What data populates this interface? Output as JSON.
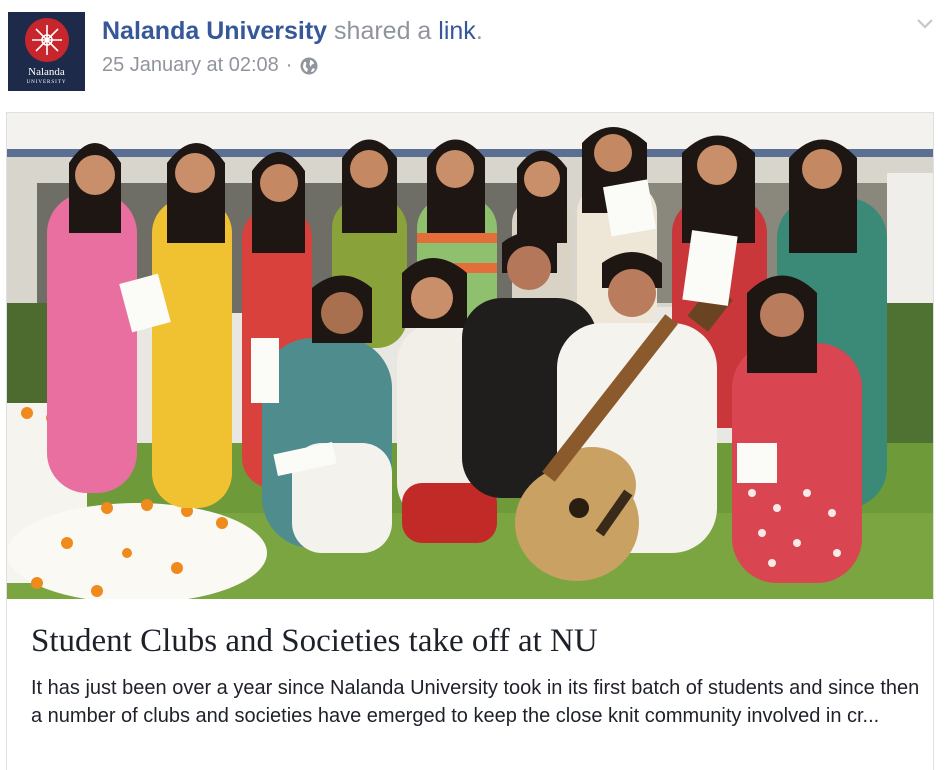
{
  "post": {
    "page_name": "Nalanda University",
    "action_text": "shared a",
    "link_word": "link",
    "period": ".",
    "timestamp": "25 January at 02:08",
    "separator": "·",
    "privacy_icon": "globe-icon",
    "menu_icon": "chevron-down-icon",
    "avatar_text": "Nalanda",
    "avatar_subtext": "UNIVERSITY"
  },
  "link_preview": {
    "image_description_icon": "photo",
    "title": "Student Clubs and Societies take off at NU",
    "description": "It has just been over a year since Nalanda University took in its first batch of students and since then a number of clubs and societies have emerged to keep the close knit community involved in cr..."
  },
  "colors": {
    "link_blue": "#365899",
    "meta_grey": "#90949c",
    "text_dark": "#1d2129",
    "avatar_bg": "#1d2a4a",
    "seal_red": "#c8262d"
  }
}
